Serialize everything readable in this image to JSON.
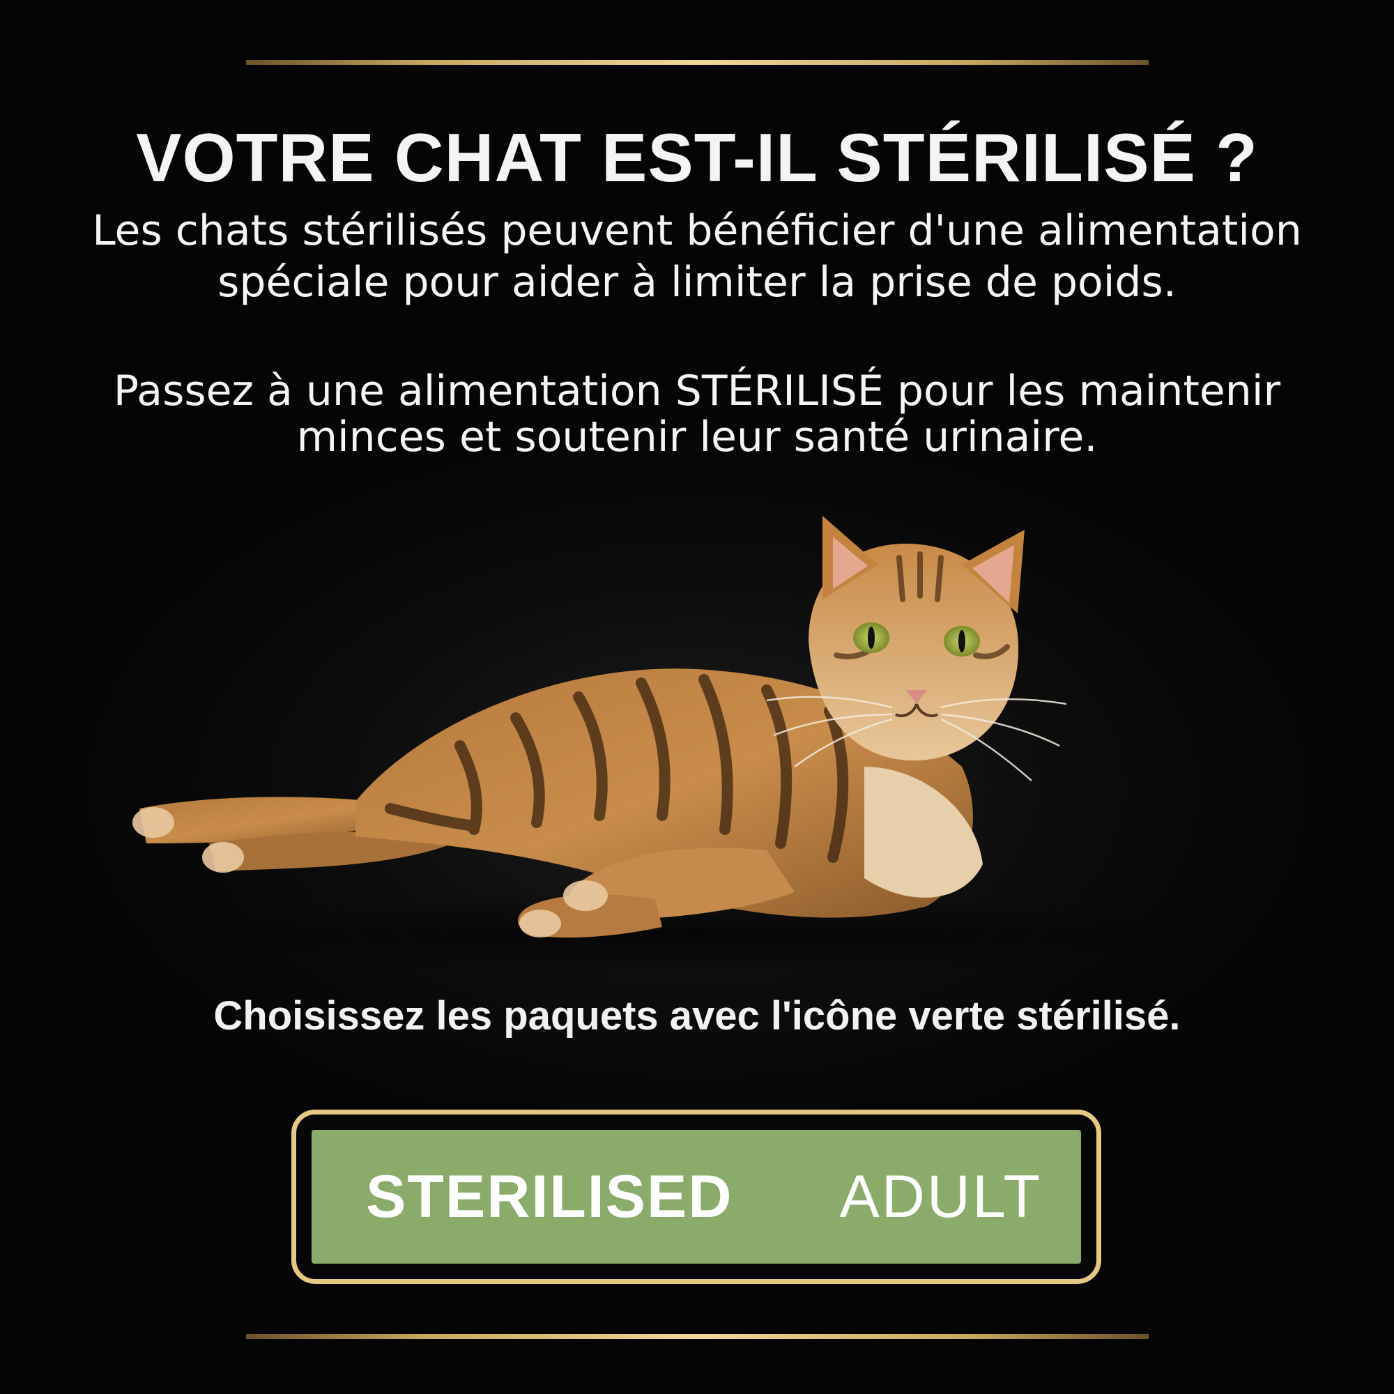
{
  "headline": "VOTRE CHAT EST-IL STÉRILISÉ ?",
  "intro": {
    "line1": "Les chats stérilisés peuvent bénéficier d'une alimentation",
    "line2": "spéciale pour aider à limiter la prise de poids."
  },
  "advice": {
    "line1": "Passez à une alimentation STÉRILISÉ pour les maintenir",
    "line2": "minces et soutenir leur santé urinaire."
  },
  "cta": "Choisissez les paquets avec l'icône verte stérilisé.",
  "badge": {
    "left_label": "STERILISED",
    "right_label": "ADULT",
    "fill_color": "#8bab6a",
    "border_color": "#e7c882"
  },
  "image": {
    "subject": "tabby-cat-lying"
  },
  "colors": {
    "background": "#050505",
    "gold_rule": "#d8b878",
    "text": "#f4f4f6"
  }
}
